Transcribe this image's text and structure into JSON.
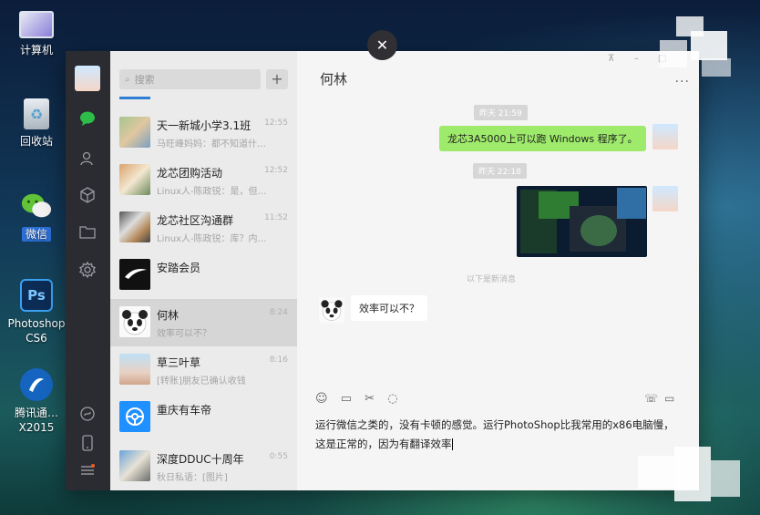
{
  "desktop": {
    "icons": [
      {
        "label": "计算机",
        "icon": "computer-icon"
      },
      {
        "label": "回收站",
        "icon": "recycle-bin-icon"
      },
      {
        "label": "微信",
        "icon": "wechat-icon"
      },
      {
        "label": "Photoshop CS6",
        "icon": "photoshop-icon",
        "glyph": "Ps"
      },
      {
        "label": "腾讯通…X2015",
        "icon": "rtx-icon"
      }
    ]
  },
  "wechat": {
    "search_placeholder": "搜索",
    "add_label": "+",
    "close_label": "✕",
    "chats": [
      {
        "name": "天一新城小学3.1班",
        "time": "12:55",
        "preview": "马旺峰妈妈：都不知道什…"
      },
      {
        "name": "龙芯团购活动",
        "time": "12:52",
        "preview": "Linux人-陈政锐：是，但…"
      },
      {
        "name": "龙芯社区沟通群",
        "time": "11:52",
        "preview": "Linux人-陈政锐：库？内…"
      },
      {
        "name": "安踏会员",
        "time": "",
        "preview": ""
      },
      {
        "name": "何林",
        "time": "8:24",
        "preview": "效率可以不？"
      },
      {
        "name": "草三叶草",
        "time": "8:16",
        "preview": "[转账]朋友已确认收钱"
      },
      {
        "name": "重庆有车帝",
        "time": "",
        "preview": ""
      },
      {
        "name": "深度DDUC十周年",
        "time": "0:55",
        "preview": "秋日私语：[图片]"
      }
    ],
    "conversation": {
      "title": "何林",
      "more_label": "···",
      "timestamps": [
        "昨天 21:59",
        "昨天 22:18"
      ],
      "messages": [
        {
          "type": "sent-text",
          "text": "龙芯3A5000上可以跑 Windows 程序了。"
        },
        {
          "type": "sent-image"
        },
        {
          "type": "received-text",
          "text": "效率可以不？"
        }
      ],
      "divider_hint": "以下是新消息",
      "input_text": "运行微信之类的，没有卡顿的感觉。运行PhotoShop比我常用的x86电脑慢，这是正常的，因为有翻译效率"
    }
  }
}
